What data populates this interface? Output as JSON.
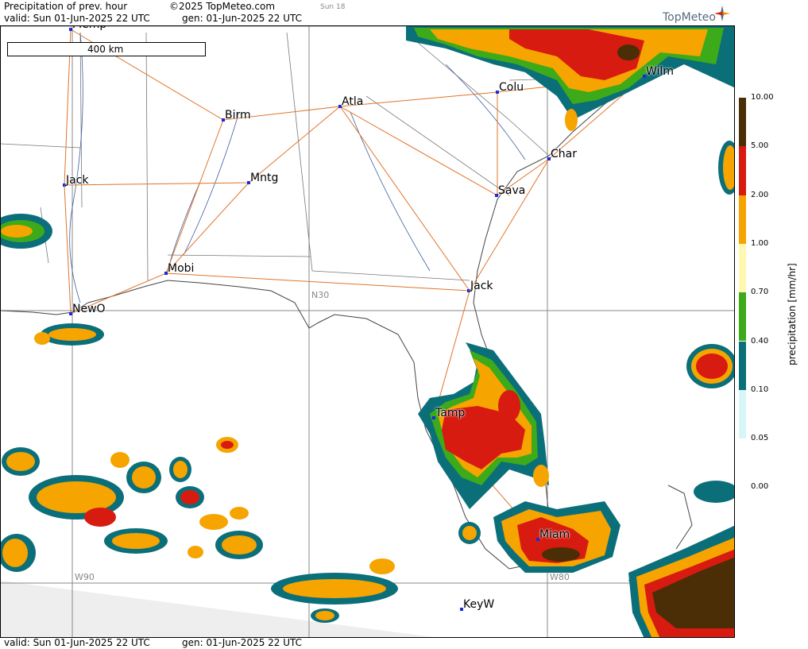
{
  "header": {
    "title": "Precipitation of prev. hour",
    "copyright": "©2025 TopMeteo.com",
    "day_code": "Sun 18",
    "valid_label": "valid:  Sun  01-Jun-2025  22 UTC",
    "gen_label": "gen: 01-Jun-2025 22 UTC"
  },
  "footer": {
    "valid_label": "valid:  Sun  01-Jun-2025  22 UTC",
    "gen_label": "gen: 01-Jun-2025 22 UTC"
  },
  "logo": {
    "text": "TopMeteo"
  },
  "scale_bar": {
    "label": "400 km"
  },
  "grid_labels": {
    "lat": "N30",
    "lon_west": "W90",
    "lon_east": "W80"
  },
  "cities": [
    {
      "id": "memp",
      "name": "Memp"
    },
    {
      "id": "birm",
      "name": "Birm"
    },
    {
      "id": "atla",
      "name": "Atla"
    },
    {
      "id": "colu",
      "name": "Colu"
    },
    {
      "id": "wilm",
      "name": "Wilm"
    },
    {
      "id": "char",
      "name": "Char"
    },
    {
      "id": "jack-ms",
      "name": "Jack"
    },
    {
      "id": "mntg",
      "name": "Mntg"
    },
    {
      "id": "sava",
      "name": "Sava"
    },
    {
      "id": "mobi",
      "name": "Mobi"
    },
    {
      "id": "jack-fl",
      "name": "Jack"
    },
    {
      "id": "newo",
      "name": "NewO"
    },
    {
      "id": "tamp",
      "name": "Tamp"
    },
    {
      "id": "miam",
      "name": "Miam"
    },
    {
      "id": "keyw",
      "name": "KeyW"
    }
  ],
  "legend": {
    "unit": "precipitation  [mm/hr]",
    "levels": [
      "10.00",
      "5.00",
      "2.00",
      "1.00",
      "0.70",
      "0.40",
      "0.10",
      "0.05",
      "0.00"
    ],
    "colors": [
      "#4b2e05",
      "#d81b10",
      "#f6a400",
      "#fff8b0",
      "#3daa1a",
      "#0b6f7a",
      "#d6f6f8"
    ]
  }
}
